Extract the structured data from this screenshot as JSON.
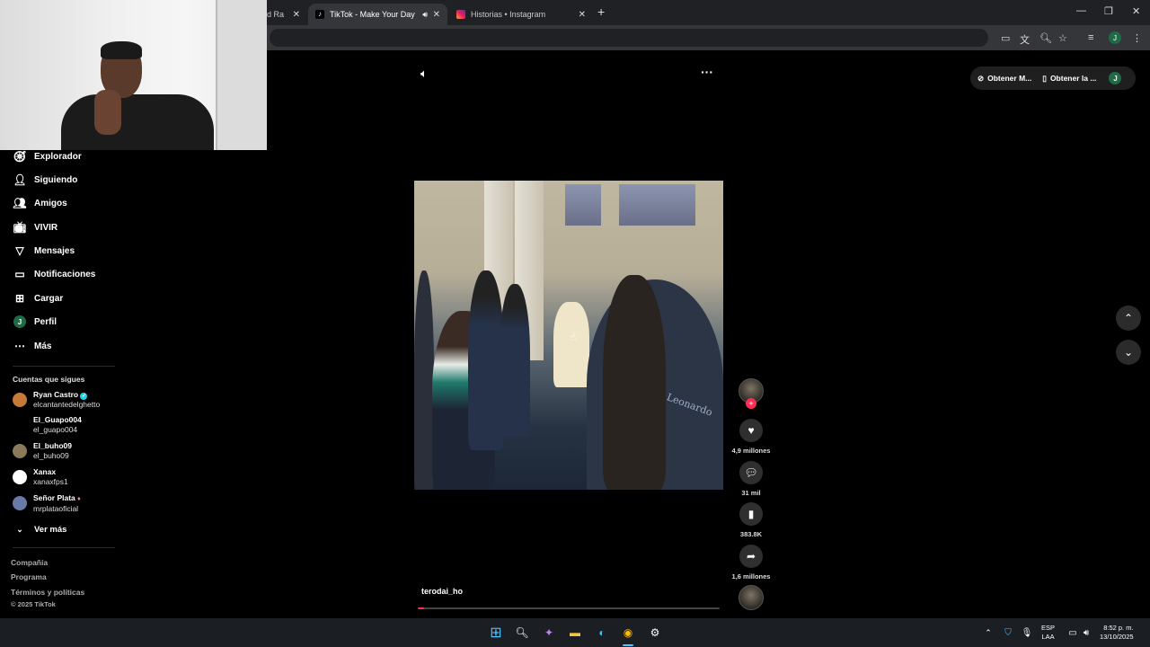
{
  "browser": {
    "tabs": [
      {
        "label": "d Ra"
      },
      {
        "label": "TikTok - Make Your Day"
      },
      {
        "label": "Historias • Instagram"
      }
    ],
    "profile_initial": "J"
  },
  "header": {
    "obtain_app_label": "Obtener M...",
    "obtain_pc_label": "Obtener la ...",
    "profile_initial": "J"
  },
  "sidebar": {
    "items": [
      {
        "label": "Explorador",
        "icon": "compass-icon"
      },
      {
        "label": "Siguiendo",
        "icon": "following-icon"
      },
      {
        "label": "Amigos",
        "icon": "friends-icon"
      },
      {
        "label": "VIVIR",
        "icon": "live-icon"
      },
      {
        "label": "Mensajes",
        "icon": "messages-icon"
      },
      {
        "label": "Notificaciones",
        "icon": "notifications-icon"
      },
      {
        "label": "Cargar",
        "icon": "upload-icon"
      },
      {
        "label": "Perfil",
        "icon": "profile-icon"
      },
      {
        "label": "Más",
        "icon": "more-icon"
      }
    ],
    "profile_initial": "J",
    "following_title": "Cuentas que sigues",
    "accounts": [
      {
        "name": "Ryan Castro",
        "handle": "elcantantedelghetto",
        "verified": true
      },
      {
        "name": "El_Guapo004",
        "handle": "el_guapo004"
      },
      {
        "name": "El_buho09",
        "handle": "el_buho09"
      },
      {
        "name": "Xanax",
        "handle": "xanaxfps1"
      },
      {
        "name": "Señor Plata",
        "handle": "mrplataoficial"
      }
    ],
    "see_more": "Ver más",
    "footer": [
      "Compañía",
      "Programa",
      "Términos y políticas",
      "© 2025 TikTok"
    ]
  },
  "video": {
    "username": "terodai_ho",
    "jacket_text": "Leonardo",
    "progress_fraction": 0.02
  },
  "actions": {
    "likes": "4,9 millones",
    "comments": "31 mil",
    "saves": "383.8K",
    "shares": "1,6 millones"
  },
  "taskbar": {
    "lang": "ESP",
    "lang2": "LAA",
    "time": "8:52 p. m.",
    "date": "13/10/2025"
  },
  "colors": {
    "accent": "#fe2c55",
    "background": "#000000"
  }
}
